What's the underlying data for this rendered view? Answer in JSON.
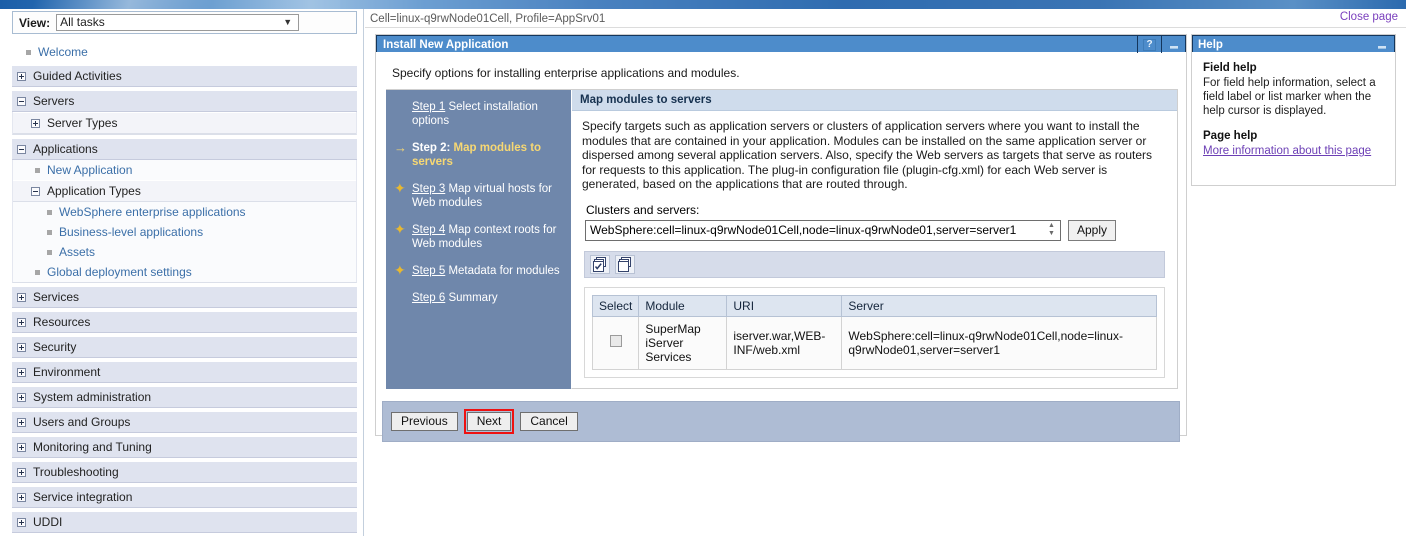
{
  "banner": {
    "name": "ibm-websphere-banner"
  },
  "sidebar": {
    "view": {
      "label": "View:",
      "value": "All tasks"
    },
    "items": [
      {
        "label": "Welcome",
        "type": "leaf",
        "link": true,
        "indent": 0
      },
      {
        "label": "Guided Activities",
        "type": "group",
        "state": "collapsed"
      },
      {
        "label": "Servers",
        "type": "group",
        "state": "expanded"
      },
      {
        "label": "Server Types",
        "type": "sub",
        "state": "collapsed"
      },
      {
        "label": "Applications",
        "type": "group",
        "state": "expanded"
      },
      {
        "label": "New Application",
        "type": "leaf",
        "link": true,
        "indent": 1
      },
      {
        "label": "Application Types",
        "type": "sub",
        "state": "expanded"
      },
      {
        "label": "WebSphere enterprise applications",
        "type": "leaf",
        "link": true,
        "indent": 2
      },
      {
        "label": "Business-level applications",
        "type": "leaf",
        "link": true,
        "indent": 2
      },
      {
        "label": "Assets",
        "type": "leaf",
        "link": true,
        "indent": 2
      },
      {
        "label": "Global deployment settings",
        "type": "leaf",
        "link": true,
        "indent": 1
      },
      {
        "label": "Services",
        "type": "group",
        "state": "collapsed"
      },
      {
        "label": "Resources",
        "type": "group",
        "state": "collapsed"
      },
      {
        "label": "Security",
        "type": "group",
        "state": "collapsed"
      },
      {
        "label": "Environment",
        "type": "group",
        "state": "collapsed"
      },
      {
        "label": "System administration",
        "type": "group",
        "state": "collapsed"
      },
      {
        "label": "Users and Groups",
        "type": "group",
        "state": "collapsed"
      },
      {
        "label": "Monitoring and Tuning",
        "type": "group",
        "state": "collapsed"
      },
      {
        "label": "Troubleshooting",
        "type": "group",
        "state": "collapsed"
      },
      {
        "label": "Service integration",
        "type": "group",
        "state": "collapsed"
      },
      {
        "label": "UDDI",
        "type": "group",
        "state": "collapsed"
      }
    ]
  },
  "header": {
    "breadcrumb": "Cell=linux-q9rwNode01Cell, Profile=AppSrv01",
    "close_page": "Close page"
  },
  "portlet": {
    "title": "Install New Application",
    "help_button": "?",
    "minimize_button": "–",
    "intro": "Specify options for installing enterprise applications and modules."
  },
  "steps": [
    {
      "num": "Step 1",
      "text": "Select installation options",
      "marker": "",
      "current": false
    },
    {
      "num": "Step 2:",
      "text": "Map modules to servers",
      "marker": "→",
      "current": true
    },
    {
      "num": "Step 3",
      "text": "Map virtual hosts for Web modules",
      "marker": "✦",
      "current": false
    },
    {
      "num": "Step 4",
      "text": "Map context roots for Web modules",
      "marker": "✦",
      "current": false
    },
    {
      "num": "Step 5",
      "text": "Metadata for modules",
      "marker": "✦",
      "current": false
    },
    {
      "num": "Step 6",
      "text": "Summary",
      "marker": "",
      "current": false
    }
  ],
  "panel": {
    "heading": "Map modules to servers",
    "description": "Specify targets such as application servers or clusters of application servers where you want to install the modules that are contained in your application. Modules can be installed on the same application server or dispersed among several application servers. Also, specify the Web servers as targets that serve as routers for requests to this application. The plug-in configuration file (plugin-cfg.xml) for each Web server is generated, based on the applications that are routed through.",
    "clusters_label": "Clusters and servers:",
    "clusters_value": "WebSphere:cell=linux-q9rwNode01Cell,node=linux-q9rwNode01,server=server1",
    "apply_label": "Apply",
    "toolbar_icons": [
      "select-all-icon",
      "deselect-all-icon"
    ],
    "table": {
      "columns": [
        "Select",
        "Module",
        "URI",
        "Server"
      ],
      "rows": [
        {
          "selected": false,
          "module": "SuperMap iServer Services",
          "uri": "iserver.war,WEB-INF/web.xml",
          "server": "WebSphere:cell=linux-q9rwNode01Cell,node=linux-q9rwNode01,server=server1"
        }
      ]
    }
  },
  "buttons": {
    "previous": "Previous",
    "next": "Next",
    "cancel": "Cancel",
    "highlight_color": "#ee1111",
    "highlighted": "Next"
  },
  "help": {
    "title": "Help",
    "minimize_button": "–",
    "field_help_heading": "Field help",
    "field_help_text": "For field help information, select a field label or list marker when the help cursor is displayed.",
    "page_help_heading": "Page help",
    "page_help_link": "More information about this page"
  }
}
